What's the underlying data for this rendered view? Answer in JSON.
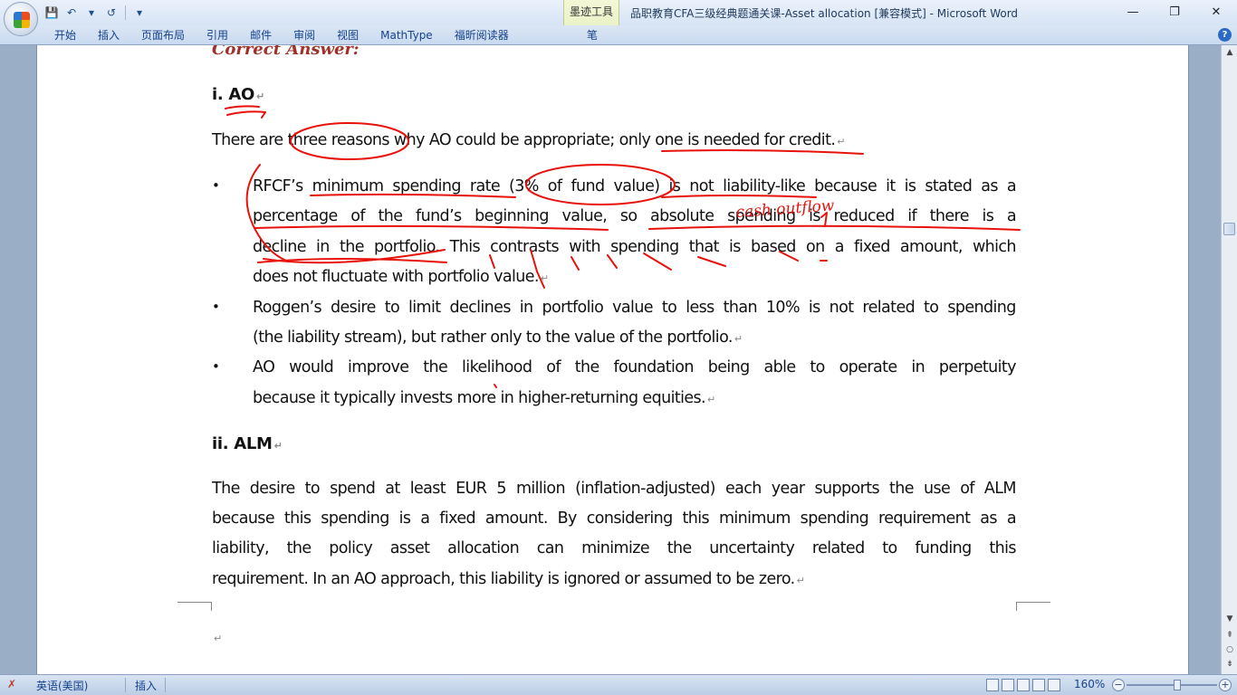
{
  "window": {
    "title": "品职教育CFA三级经典题通关课-Asset allocation [兼容模式] - Microsoft Word",
    "context_tab": "墨迹工具",
    "controls": {
      "minimize": "—",
      "restore": "❐",
      "close": "✕"
    }
  },
  "quick_access": {
    "save_icon": "💾",
    "undo_icon": "↶",
    "redo_icon": "↺",
    "more_icon": "▾"
  },
  "ribbon": {
    "tabs": [
      "开始",
      "插入",
      "页面布局",
      "引用",
      "邮件",
      "审阅",
      "视图",
      "MathType",
      "福昕阅读器"
    ],
    "pen_tab": "笔",
    "help": "?"
  },
  "document": {
    "correct_answer": "Correct Answer:",
    "para_mark": "↵",
    "section1_heading": "i. AO",
    "intro": "There are three reasons why AO could be appropriate; only one is needed for credit.",
    "bullet_symbol": "•",
    "bullet1": {
      "l1": [
        "RFCF’s",
        "minimum",
        "spending",
        "rate",
        "(3%",
        "of",
        "fund",
        "value)",
        "is",
        "not",
        "liability-like",
        "because",
        "it",
        "is",
        "stated",
        "as",
        "a"
      ],
      "l2": [
        "percentage",
        "of",
        "the",
        "fund’s",
        "beginning",
        "value,",
        "so",
        "absolute",
        "spending",
        "is",
        "reduced",
        "if",
        "there",
        "is",
        "a"
      ],
      "l3": [
        "decline",
        "in",
        "the",
        "portfolio.",
        "This",
        "contrasts",
        "with",
        "spending",
        "that",
        "is",
        "based",
        "on",
        "a",
        "fixed",
        "amount,",
        "which"
      ],
      "l4": "does not fluctuate with portfolio value."
    },
    "bullet2": {
      "l1": [
        "Roggen’s",
        "desire",
        "to",
        "limit",
        "declines",
        "in",
        "portfolio",
        "value",
        "to",
        "less",
        "than",
        "10%",
        "is",
        "not",
        "related",
        "to",
        "spending"
      ],
      "l2": "(the liability stream), but rather only to the value of the portfolio."
    },
    "bullet3": {
      "l1": [
        "AO",
        "would",
        "improve",
        "the",
        "likelihood",
        "of",
        "the",
        "foundation",
        "being",
        "able",
        "to",
        "operate",
        "in",
        "perpetuity"
      ],
      "l2": "because it typically invests more in higher-returning equities."
    },
    "section2_heading": "ii. ALM",
    "alm": {
      "l1": [
        "The",
        "desire",
        "to",
        "spend",
        "at",
        "least",
        "EUR",
        "5",
        "million",
        "(inflation-adjusted)",
        "each",
        "year",
        "supports",
        "the",
        "use",
        "of",
        "ALM"
      ],
      "l2": [
        "because",
        "this",
        "spending",
        "is",
        "a",
        "fixed",
        "amount.",
        "By",
        "considering",
        "this",
        "minimum",
        "spending",
        "requirement",
        "as",
        "a"
      ],
      "l3": [
        "liability,",
        "the",
        "policy",
        "asset",
        "allocation",
        "can",
        "minimize",
        "the",
        "uncertainty",
        "related",
        "to",
        "funding",
        "this"
      ],
      "l4": "requirement. In an AO approach, this liability is ignored or assumed to be zero."
    },
    "annotation_text": "cash outflow"
  },
  "scrollbar": {
    "up": "▲",
    "down": "▼",
    "prev_page": "⇞",
    "next_page": "⇟",
    "select_browse": "○"
  },
  "status": {
    "language": "英语(美国)",
    "insert_mode": "插入",
    "zoom": "160%",
    "zoom_out": "−",
    "zoom_in": "+"
  },
  "colors": {
    "ink": "#e8120c",
    "ribbon_text": "#15428b"
  }
}
